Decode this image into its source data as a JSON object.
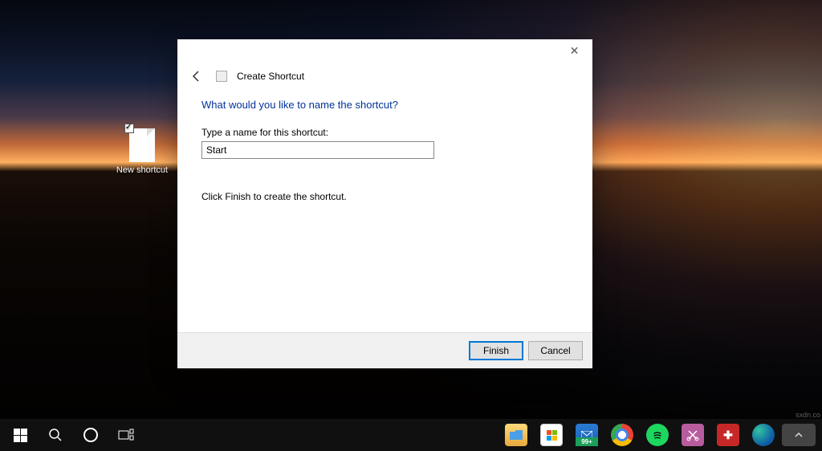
{
  "desktop": {
    "icon": {
      "label": "New shortcut"
    }
  },
  "dialog": {
    "title": "Create Shortcut",
    "instruction": "What would you like to name the shortcut?",
    "field_label": "Type a name for this shortcut:",
    "input_value": "Start",
    "helper": "Click Finish to create the shortcut.",
    "buttons": {
      "finish": "Finish",
      "cancel": "Cancel"
    }
  },
  "taskbar": {
    "mail_badge": "99+"
  },
  "watermark": "sxdn.co"
}
